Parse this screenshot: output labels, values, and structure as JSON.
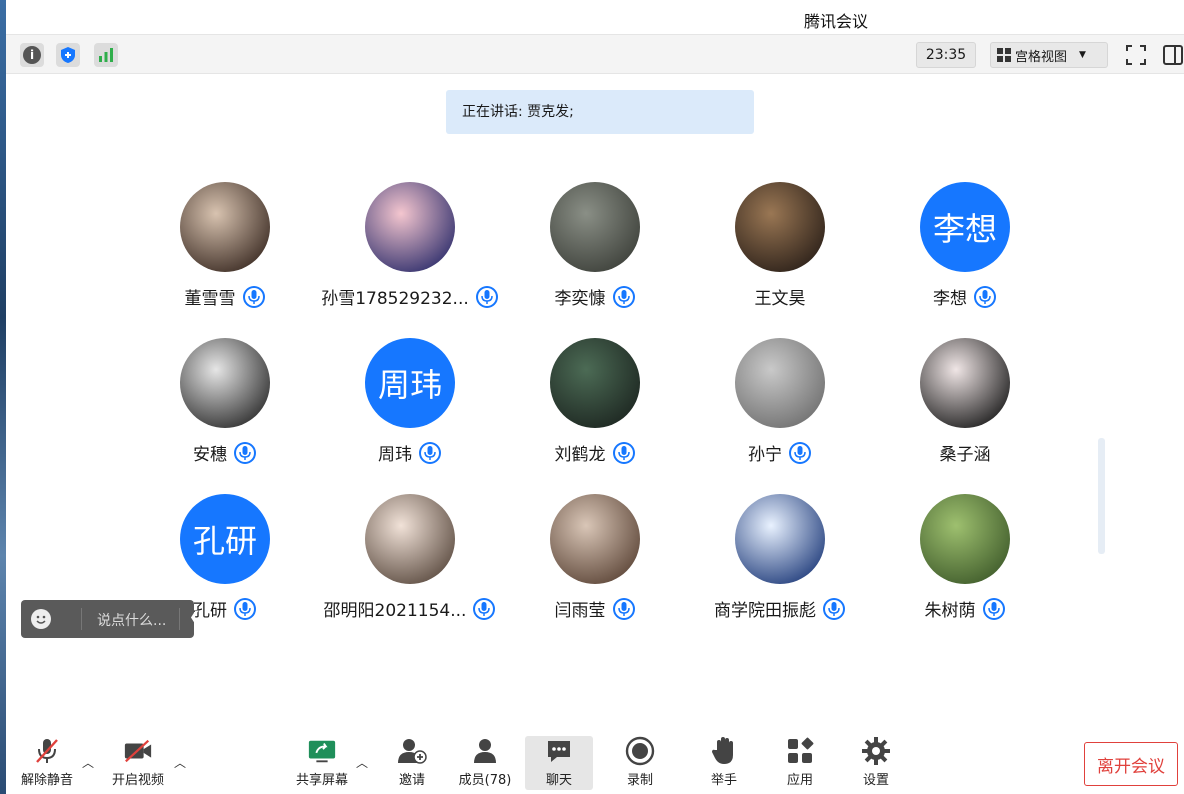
{
  "window": {
    "title": "腾讯会议"
  },
  "top_toolbar": {
    "time": "23:35",
    "view_mode": "宫格视图"
  },
  "speaking": {
    "text": "正在讲话: 贾克发;"
  },
  "participants": [
    {
      "name": "董雪雪",
      "avatar": "photo",
      "colors": [
        "#d8c3b0",
        "#3a2a22"
      ],
      "mic": "on"
    },
    {
      "name": "孙雪178529232...",
      "avatar": "photo",
      "colors": [
        "#f4c6cf",
        "#2d2d6b"
      ],
      "mic": "on"
    },
    {
      "name": "李奕慷",
      "avatar": "photo",
      "colors": [
        "#8a8f86",
        "#3c3f39"
      ],
      "mic": "on"
    },
    {
      "name": "王文昊",
      "avatar": "photo",
      "colors": [
        "#9a7754",
        "#2a1f18"
      ],
      "mic": "none"
    },
    {
      "name": "李想",
      "avatar": "text",
      "avatar_text": "李想",
      "mic": "on"
    },
    {
      "name": "安穗",
      "avatar": "photo",
      "colors": [
        "#e6e6e6",
        "#2b2b2b"
      ],
      "mic": "on"
    },
    {
      "name": "周玮",
      "avatar": "text",
      "avatar_text": "周玮",
      "mic": "on"
    },
    {
      "name": "刘鹤龙",
      "avatar": "photo",
      "colors": [
        "#4c6b55",
        "#1c2520"
      ],
      "mic": "on"
    },
    {
      "name": "孙宁",
      "avatar": "photo",
      "colors": [
        "#c9c9c9",
        "#6e6e6e"
      ],
      "mic": "on"
    },
    {
      "name": "桑子涵",
      "avatar": "photo",
      "colors": [
        "#f0e6e6",
        "#1a1a1a"
      ],
      "mic": "none"
    },
    {
      "name": "孔研",
      "avatar": "text",
      "avatar_text": "孔研",
      "mic": "on"
    },
    {
      "name": "邵明阳2021154...",
      "avatar": "photo",
      "colors": [
        "#f1e2d8",
        "#5a4a3f"
      ],
      "mic": "on"
    },
    {
      "name": "闫雨莹",
      "avatar": "photo",
      "colors": [
        "#d9c6b7",
        "#5b4436"
      ],
      "mic": "on"
    },
    {
      "name": "商学院田振彪",
      "avatar": "photo",
      "colors": [
        "#e9f2ff",
        "#1f3b7a"
      ],
      "mic": "on"
    },
    {
      "name": "朱树荫",
      "avatar": "photo",
      "colors": [
        "#9ec06f",
        "#3e5a2a"
      ],
      "mic": "on"
    }
  ],
  "chat_popup": {
    "placeholder": "说点什么..."
  },
  "bottom_bar": {
    "unmute": "解除静音",
    "start_video": "开启视频",
    "share_screen": "共享屏幕",
    "invite": "邀请",
    "members": "成员(78)",
    "chat": "聊天",
    "record": "录制",
    "raise_hand": "举手",
    "apps": "应用",
    "settings": "设置",
    "leave": "离开会议"
  },
  "colors": {
    "accent": "#1677ff",
    "leave": "#e0413c",
    "banner": "#dbeafa"
  }
}
